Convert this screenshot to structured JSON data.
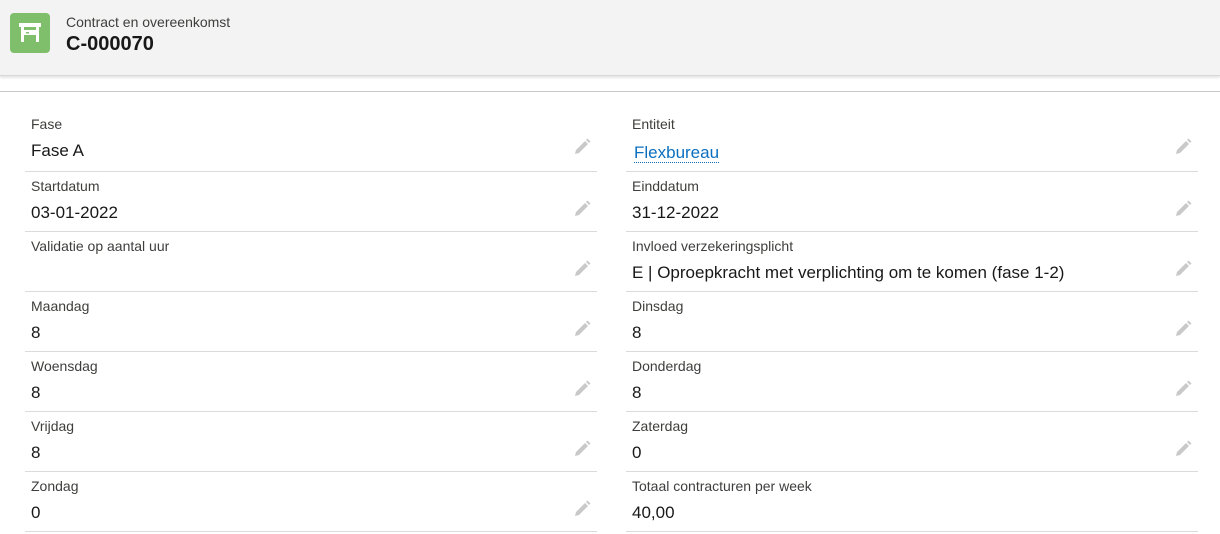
{
  "header": {
    "object_type": "Contract en overeenkomst",
    "record_name": "C-000070",
    "icon": "contract-icon",
    "icon_color": "#7fbe6b"
  },
  "fields_left": [
    {
      "label": "Fase",
      "value": "Fase A",
      "editable": true
    },
    {
      "label": "Startdatum",
      "value": "03-01-2022",
      "editable": true
    },
    {
      "label": "Validatie op aantal uur",
      "value": "",
      "editable": true
    },
    {
      "label": "Maandag",
      "value": "8",
      "editable": true
    },
    {
      "label": "Woensdag",
      "value": "8",
      "editable": true
    },
    {
      "label": "Vrijdag",
      "value": "8",
      "editable": true
    },
    {
      "label": "Zondag",
      "value": "0",
      "editable": true
    }
  ],
  "fields_right": [
    {
      "label": "Entiteit",
      "value": "Flexbureau",
      "editable": true,
      "link": true
    },
    {
      "label": "Einddatum",
      "value": "31-12-2022",
      "editable": true
    },
    {
      "label": "Invloed verzekeringsplicht",
      "value": "E | Oproepkracht met verplichting om te komen (fase 1-2)",
      "editable": true
    },
    {
      "label": "Dinsdag",
      "value": "8",
      "editable": true
    },
    {
      "label": "Donderdag",
      "value": "8",
      "editable": true
    },
    {
      "label": "Zaterdag",
      "value": "0",
      "editable": true
    },
    {
      "label": "Totaal contracturen per week",
      "value": "40,00",
      "editable": false
    }
  ],
  "colors": {
    "link": "#0b6fbf",
    "edit_icon": "#c9c9c9"
  }
}
